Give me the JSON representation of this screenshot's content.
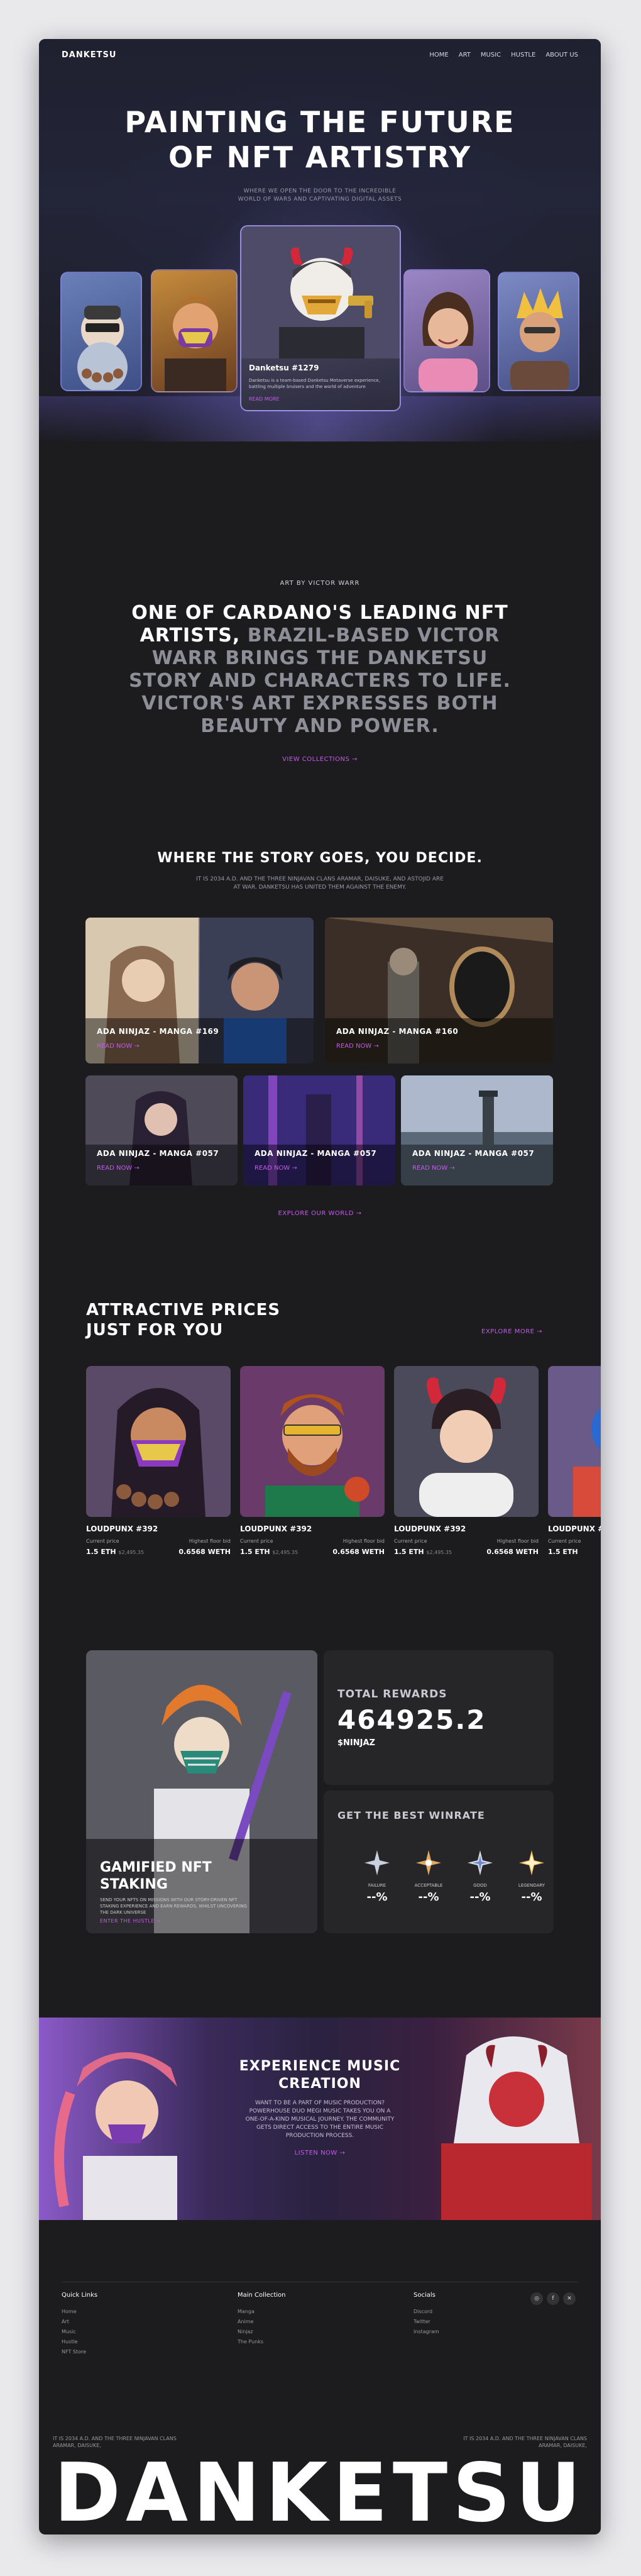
{
  "brand": "DANKETSU",
  "nav": [
    "HOME",
    "ART",
    "MUSIC",
    "HUSTLE",
    "ABOUT US"
  ],
  "hero": {
    "title_line1": "PAINTING THE FUTURE",
    "title_line2": "OF NFT ARTISTRY",
    "subtitle_line1": "WHERE WE OPEN THE DOOR TO THE INCREDIBLE",
    "subtitle_line2": "WORLD OF WARS AND CAPTIVATING DIGITAL ASSETS",
    "featured_name": "Danketsu #1279",
    "featured_desc": "Danketsu is a team-based Danketsu Metaverse experience, battling multiple bruisers and the world of adventure",
    "featured_link": "READ MORE"
  },
  "about": {
    "kicker": "ART BY VICTOR WARR",
    "statement_bright": "ONE OF CARDANO'S LEADING NFT ARTISTS,",
    "statement_dim": "BRAZIL-BASED VICTOR WARR BRINGS THE DANKETSU STORY AND CHARACTERS TO LIFE. VICTOR'S ART EXPRESSES BOTH BEAUTY AND POWER.",
    "cta": "VIEW COLLECTIONS →"
  },
  "story": {
    "title": "WHERE THE STORY GOES, YOU DECIDE.",
    "sub_line1": "IT IS 2034 A.D. AND THE THREE NINJAVAN CLANS ARAMAR, DAISUKE, AND ASTOJID ARE",
    "sub_line2": "AT WAR. DANKETSU HAS UNITED THEM AGAINST THE ENEMY.",
    "cards": [
      {
        "title": "ADA NINJAZ - MANGA #169",
        "link": "READ NOW →"
      },
      {
        "title": "ADA NINJAZ - MANGA #160",
        "link": "READ NOW →"
      },
      {
        "title": "ADA NINJAZ - MANGA #057",
        "link": "READ NOW →"
      },
      {
        "title": "ADA NINJAZ - MANGA #057",
        "link": "READ NOW →"
      },
      {
        "title": "ADA NINJAZ - MANGA #057",
        "link": "READ NOW →"
      }
    ],
    "cta": "EXPLORE OUR WORLD →"
  },
  "prices": {
    "title_line1": "ATTRACTIVE PRICES",
    "title_line2": "JUST FOR YOU",
    "cta": "EXPLORE MORE →",
    "current_label": "Current price",
    "floor_label": "Highest floor bid",
    "cards": [
      {
        "title": "LOUDPUNX #392",
        "price": "1.5 ETH",
        "usd": "$2,495.35",
        "bid": "0.6568 WETH"
      },
      {
        "title": "LOUDPUNX #392",
        "price": "1.5 ETH",
        "usd": "$2,495.35",
        "bid": "0.6568 WETH"
      },
      {
        "title": "LOUDPUNX #392",
        "price": "1.5 ETH",
        "usd": "$2,495.35",
        "bid": "0.6568 WETH"
      },
      {
        "title": "LOUDPUNX #",
        "price": "1.5 ETH",
        "usd": "",
        "bid": ""
      }
    ]
  },
  "staking": {
    "title_line1": "GAMIFIED NFT",
    "title_line2": "STAKING",
    "desc": "SEND YOUR NFTS ON MISSIONS WITH OUR STORY-DRIVEN NFT STAKING EXPERIENCE AND EARN REWARDS, WHILST UNCOVERING THE DARK UNIVERSE",
    "cta": "ENTER THE HUSTLE →",
    "rewards_label": "TOTAL REWARDS",
    "rewards_value": "464925.2",
    "rewards_unit": "$NINJAZ",
    "winrate_label": "GET THE BEST WINRATE",
    "ranks": [
      {
        "name": "FAILURE",
        "val": "--%"
      },
      {
        "name": "ACCEPTABLE",
        "val": "--%"
      },
      {
        "name": "GOOD",
        "val": "--%"
      },
      {
        "name": "LEGENDARY",
        "val": "--%"
      }
    ]
  },
  "music": {
    "title_line1": "EXPERIENCE MUSIC",
    "title_line2": "CREATION",
    "desc": "WANT TO BE A PART OF MUSIC PRODUCTION? POWERHOUSE DUO MEGI MUSIC TAKES YOU ON A ONE-OF-A-KIND MUSICAL JOURNEY. THE COMMUNITY GETS DIRECT ACCESS TO THE ENTIRE MUSIC PRODUCTION PROCESS.",
    "cta": "LISTEN NOW →"
  },
  "footer": {
    "quick_title": "Quick Links",
    "quick": [
      "Home",
      "Art",
      "Music",
      "Hustle",
      "NFT Store"
    ],
    "main_title": "Main Collection",
    "main": [
      "Manga",
      "Anime",
      "Ninjaz",
      "The Punks"
    ],
    "social_title": "Socials",
    "social": [
      "Discord",
      "Twitter",
      "Instagram"
    ],
    "legal_left_1": "IT IS 2034 A.D. AND THE THREE NINJAVAN CLANS",
    "legal_left_2": "ARAMAR, DAISUKE,",
    "legal_right_1": "IT IS 2034 A.D. AND THE THREE NINJAVAN CLANS",
    "legal_right_2": "ARAMAR, DAISUKE,",
    "wordmark": "DANKETSU"
  }
}
